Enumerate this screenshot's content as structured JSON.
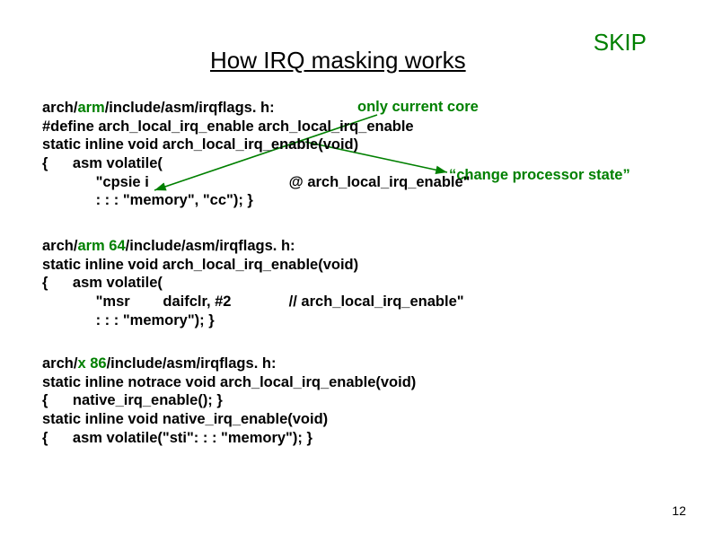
{
  "skip": "SKIP",
  "title": "How IRQ masking works",
  "anno_only": "only current core",
  "anno_change": "“change processor state”",
  "block1": {
    "l1a": "arch/",
    "l1b": "arm",
    "l1c": "/include/asm/irqflags. h:",
    "l2": "#define arch_local_irq_enable arch_local_irq_enable",
    "l3": "static inline void arch_local_irq_enable(void)",
    "l4": "{      asm volatile(",
    "l5": "             \"cpsie i                                  @ arch_local_irq_enable\"",
    "l6": "             : : : \"memory\", \"cc\"); }"
  },
  "block2": {
    "l1a": "arch/",
    "l1b": "arm 64",
    "l1c": "/include/asm/irqflags. h:",
    "l2": "static inline void arch_local_irq_enable(void)",
    "l3": "{      asm volatile(",
    "l4": "             \"msr        daifclr, #2              // arch_local_irq_enable\"",
    "l5": "             : : : \"memory\"); }"
  },
  "block3": {
    "l1a": "arch/",
    "l1b": "x 86",
    "l1c": "/include/asm/irqflags. h:",
    "l2": "static inline notrace void arch_local_irq_enable(void)",
    "l3": "{      native_irq_enable(); }",
    "l4": "static inline void native_irq_enable(void)",
    "l5": "{      asm volatile(\"sti\": : : \"memory\"); }"
  },
  "pagenum": "12"
}
